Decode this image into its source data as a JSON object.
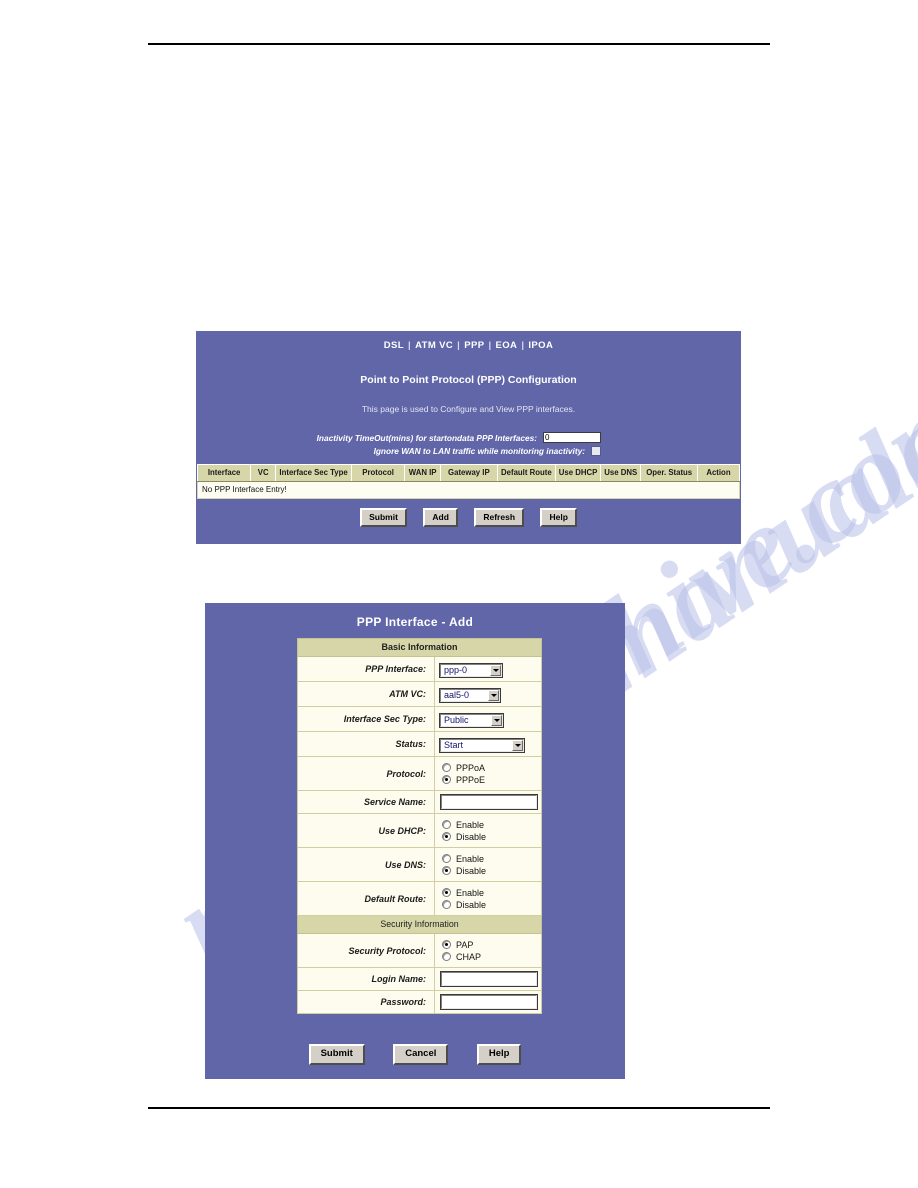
{
  "watermark": {
    "text": "manualarchive.com"
  },
  "config_panel": {
    "nav": {
      "items": [
        "DSL",
        "ATM VC",
        "PPP",
        "EOA",
        "IPOA"
      ],
      "separator": "|"
    },
    "title": "Point to Point Protocol (PPP) Configuration",
    "subtitle": "This page is used to Configure and View PPP interfaces.",
    "inactivity": {
      "timeout_label": "Inactivity TimeOut(mins) for startondata PPP Interfaces:",
      "timeout_value": "0",
      "ignore_label": "Ignore WAN to LAN traffic while monitoring inactivity:",
      "ignore_checked": false
    },
    "table": {
      "headers": [
        "Interface",
        "VC",
        "Interface Sec Type",
        "Protocol",
        "WAN IP",
        "Gateway IP",
        "Default Route",
        "Use DHCP",
        "Use DNS",
        "Oper. Status",
        "Action"
      ],
      "empty_message": "No PPP Interface Entry!"
    },
    "buttons": [
      "Submit",
      "Add",
      "Refresh",
      "Help"
    ]
  },
  "add_panel": {
    "title": "PPP Interface - Add",
    "sections": {
      "basic": "Basic Information",
      "security": "Security Information"
    },
    "fields": {
      "ppp_interface": {
        "label": "PPP Interface:",
        "value": "ppp-0"
      },
      "atm_vc": {
        "label": "ATM VC:",
        "value": "aal5-0"
      },
      "interface_sec_type": {
        "label": "Interface Sec Type:",
        "value": "Public"
      },
      "status": {
        "label": "Status:",
        "value": "Start"
      },
      "protocol": {
        "label": "Protocol:",
        "options": [
          "PPPoA",
          "PPPoE"
        ],
        "selected": "PPPoE"
      },
      "service_name": {
        "label": "Service Name:",
        "value": ""
      },
      "use_dhcp": {
        "label": "Use DHCP:",
        "options": [
          "Enable",
          "Disable"
        ],
        "selected": "Disable"
      },
      "use_dns": {
        "label": "Use DNS:",
        "options": [
          "Enable",
          "Disable"
        ],
        "selected": "Disable"
      },
      "default_route": {
        "label": "Default Route:",
        "options": [
          "Enable",
          "Disable"
        ],
        "selected": "Enable"
      },
      "security_protocol": {
        "label": "Security Protocol:",
        "options": [
          "PAP",
          "CHAP"
        ],
        "selected": "PAP"
      },
      "login_name": {
        "label": "Login Name:",
        "value": ""
      },
      "password": {
        "label": "Password:",
        "value": ""
      }
    },
    "buttons": [
      "Submit",
      "Cancel",
      "Help"
    ]
  },
  "colors": {
    "panel_bg": "#6166a8",
    "header_khaki": "#d6d6a8",
    "field_bg": "#fdfcee",
    "button_face": "#d4d0c8",
    "select_text": "#12126a",
    "watermark": "#b9c0e8"
  }
}
